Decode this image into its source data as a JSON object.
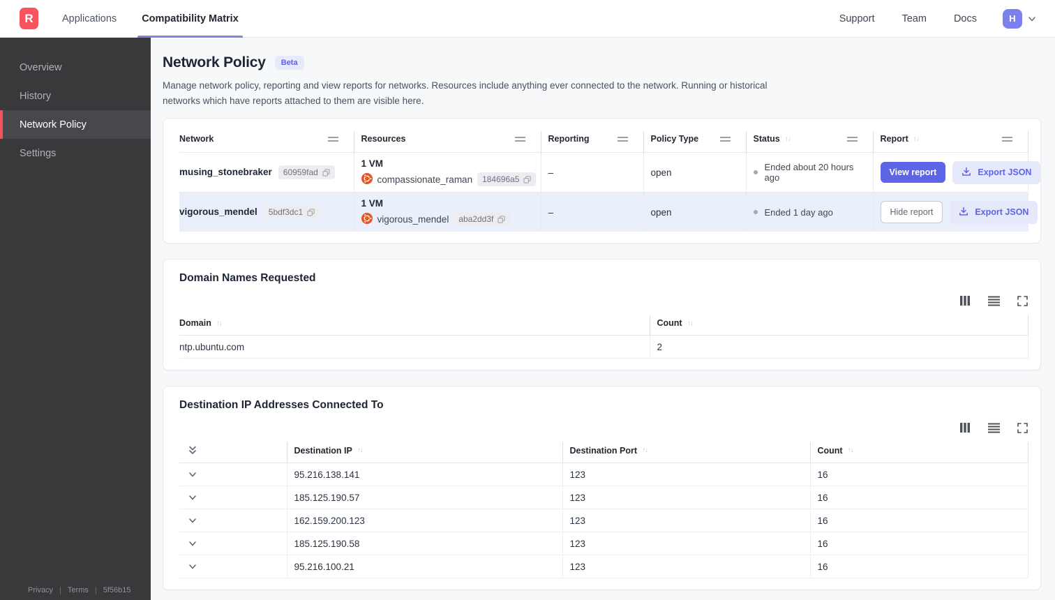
{
  "topnav": {
    "logo_letter": "R",
    "tabs": [
      {
        "label": "Applications"
      },
      {
        "label": "Compatibility Matrix"
      }
    ],
    "links": [
      "Support",
      "Team",
      "Docs"
    ],
    "avatar_initial": "H"
  },
  "sidebar": {
    "items": [
      {
        "label": "Overview"
      },
      {
        "label": "History"
      },
      {
        "label": "Network Policy"
      },
      {
        "label": "Settings"
      }
    ],
    "footer": {
      "privacy": "Privacy",
      "terms": "Terms",
      "build": "5f56b15"
    }
  },
  "page": {
    "title": "Network Policy",
    "beta_badge": "Beta",
    "description": "Manage network policy, reporting and view reports for networks. Resources include anything ever connected to the network. Running or historical networks which have reports attached to them are visible here."
  },
  "networks_table": {
    "columns": [
      "Network",
      "Resources",
      "Reporting",
      "Policy Type",
      "Status",
      "Report"
    ],
    "rows": [
      {
        "name": "musing_stonebraker",
        "id": "60959fad",
        "resources_count": "1 VM",
        "resource_name": "compassionate_raman",
        "resource_id": "184696a5",
        "reporting": "–",
        "policy_type": "open",
        "status": "Ended about 20 hours ago",
        "report_button": "View report",
        "export_button": "Export JSON"
      },
      {
        "name": "vigorous_mendel",
        "id": "5bdf3dc1",
        "resources_count": "1 VM",
        "resource_name": "vigorous_mendel",
        "resource_id": "aba2dd3f",
        "reporting": "–",
        "policy_type": "open",
        "status": "Ended 1 day ago",
        "report_button": "Hide report",
        "export_button": "Export JSON"
      }
    ]
  },
  "domains_card": {
    "title": "Domain Names Requested",
    "columns": [
      "Domain",
      "Count"
    ],
    "rows": [
      {
        "domain": "ntp.ubuntu.com",
        "count": "2"
      }
    ]
  },
  "destinations_card": {
    "title": "Destination IP Addresses Connected To",
    "columns": [
      "Destination IP",
      "Destination Port",
      "Count"
    ],
    "rows": [
      {
        "ip": "95.216.138.141",
        "port": "123",
        "count": "16"
      },
      {
        "ip": "185.125.190.57",
        "port": "123",
        "count": "16"
      },
      {
        "ip": "162.159.200.123",
        "port": "123",
        "count": "16"
      },
      {
        "ip": "185.125.190.58",
        "port": "123",
        "count": "16"
      },
      {
        "ip": "95.216.100.21",
        "port": "123",
        "count": "16"
      }
    ]
  },
  "colors": {
    "brand_red": "#f9545e",
    "sidebar_accent_red": "#f4515e",
    "accent_indigo": "#5d64e6",
    "active_tab_underline": "#7b82ea",
    "selected_row_highlight": "#e9effb",
    "ubuntu_orange": "#e95420",
    "beta_badge_bg": "#e7e9fc"
  }
}
